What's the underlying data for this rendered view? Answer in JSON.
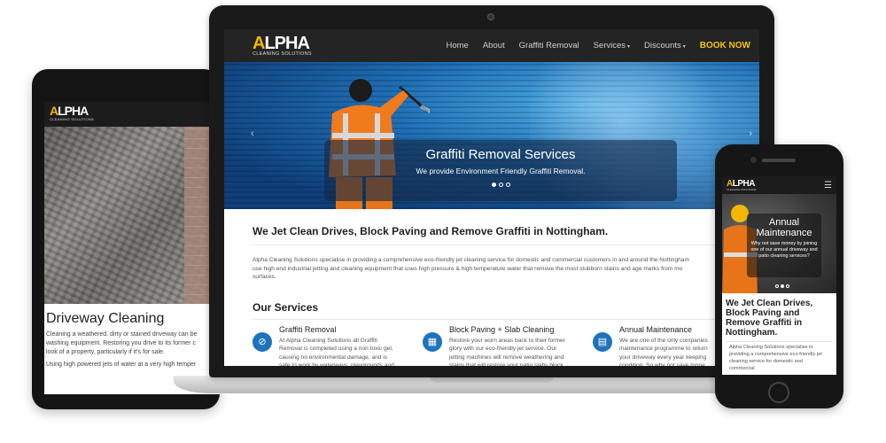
{
  "tablet": {
    "logo_word": "LPHA",
    "logo_first": "A",
    "logo_sub": "CLEANING SOLUTIONS",
    "title": "Driveway Cleaning",
    "text_1": "Cleaning a weathered, dirty or stained driveway can be\nwashing equipment. Restoring you drive to its former c\nlook of a property, particularly if it's for sale.",
    "text_2": "Using high powered jets of water at a very high temper"
  },
  "laptop": {
    "logo_word": "LPHA",
    "logo_first": "A",
    "logo_sub": "CLEANING SOLUTIONS",
    "nav": {
      "home": "Home",
      "about": "About",
      "graffiti": "Graffiti Removal",
      "services": "Services",
      "discounts": "Discounts",
      "book": "BOOK NOW"
    },
    "hero": {
      "title": "Graffiti Removal Services",
      "subtitle": "We provide Environment Friendly Graffiti Removal."
    },
    "heading": "We Jet Clean Drives, Block Paving and Remove Graffiti in Nottingham.",
    "intro": "Alpha Cleaning Solutions specialise in providing a comprehensive eco-friendly jet cleaning service for domestic and commercial customers in and around the Nottingham\nuse high end industrial jetting and cleaning equipment that uses high pressure & high temperature water that remove the most stubborn stains and age marks from mo\nsurfaces.",
    "services_heading": "Our Services",
    "services": [
      {
        "icon": "ban-icon",
        "title": "Graffiti Removal",
        "text": "At Alpha Cleaning Solutions all Graffiti\nRemoval is completed using a non toxic gel,\ncausing no environmental damage, and is\nsafe to work by waterways, playgrounds and"
      },
      {
        "icon": "grid-icon",
        "title": "Block Paving + Slab Cleaning",
        "text": "Restore your worn areas back to their former\nglory with our eco-friendly jet service. Our\njetting machines will remove weathering and\nstains that will restore your patio slabs block"
      },
      {
        "icon": "calendar-icon",
        "title": "Annual Maintenance",
        "text": "We are one of the only companies\nmaintenance programme to return\nyour driveway every year keeping\ncondition. So why not save mone"
      }
    ]
  },
  "phone": {
    "logo_word": "LPHA",
    "logo_first": "A",
    "logo_sub": "CLEANING SOLUTIONS",
    "menu_icon": "☰",
    "hero_title": "Annual\nMaintenance",
    "hero_text": "Why not save money by joining one of our annual driveway and patio cleaning services?",
    "heading": "We Jet Clean Drives, Block Paving and Remove Graffiti in Nottingham.",
    "intro": "Alpha Cleaning Solutions specialise in\nproviding a comprehensive eco-friendly jet\ncleaning service for domestic and commercial"
  },
  "colors": {
    "accent_yellow": "#f2c40f",
    "icon_blue": "#1e73be",
    "nav_dark": "#242424"
  }
}
